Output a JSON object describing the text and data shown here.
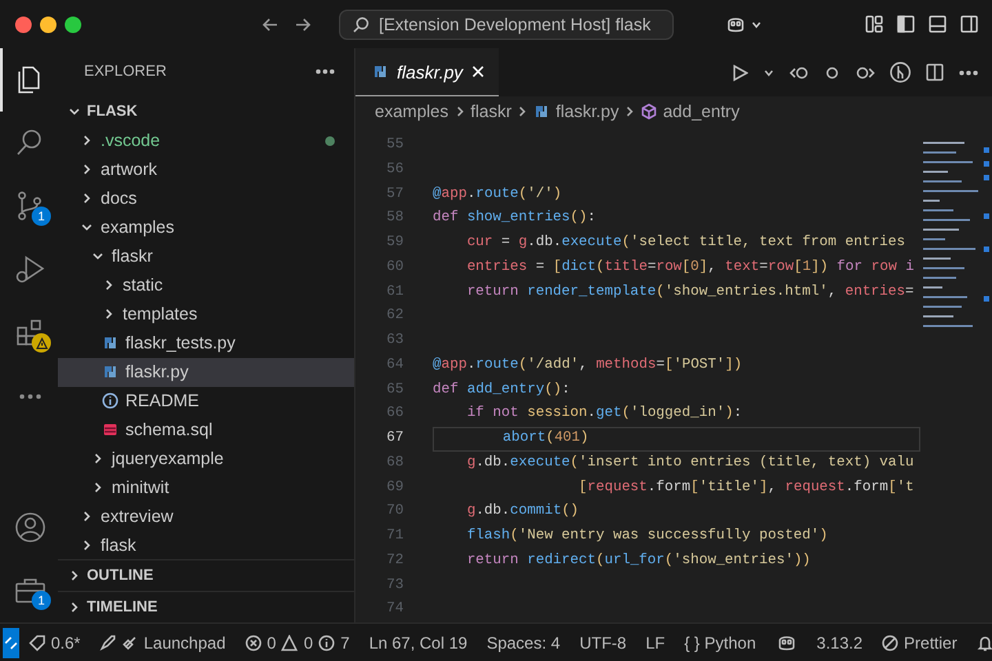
{
  "window": {
    "title": "[Extension Development Host] flask"
  },
  "activity_bar": {
    "items": [
      {
        "kind": "files",
        "selected": true
      },
      {
        "kind": "search",
        "selected": false
      },
      {
        "kind": "source-control",
        "selected": false,
        "badge": {
          "kind": "count",
          "text": "1"
        }
      },
      {
        "kind": "run",
        "selected": false
      },
      {
        "kind": "extensions",
        "selected": false,
        "badge": {
          "kind": "warning"
        }
      },
      {
        "kind": "more",
        "selected": false
      }
    ],
    "bottom": [
      {
        "kind": "account"
      },
      {
        "kind": "manage",
        "badge": {
          "kind": "count",
          "text": "1"
        }
      }
    ]
  },
  "sidebar": {
    "title": "EXPLORER",
    "root": {
      "label": "FLASK",
      "expanded": true
    },
    "tree": [
      {
        "label": ".vscode",
        "kind": "folder",
        "expanded": false,
        "untracked": true,
        "selected": false
      },
      {
        "label": "artwork",
        "kind": "folder",
        "expanded": false,
        "untracked": false,
        "selected": false
      },
      {
        "label": "docs",
        "kind": "folder",
        "expanded": false,
        "untracked": false,
        "selected": false
      },
      {
        "label": "examples",
        "kind": "folder",
        "expanded": true,
        "untracked": false,
        "selected": false,
        "children": [
          {
            "label": "flaskr",
            "kind": "folder",
            "expanded": true,
            "untracked": false,
            "selected": false,
            "children": [
              {
                "label": "static",
                "kind": "folder",
                "expanded": false,
                "untracked": false,
                "selected": false
              },
              {
                "label": "templates",
                "kind": "folder",
                "expanded": false,
                "untracked": false,
                "selected": false
              },
              {
                "label": "flaskr_tests.py",
                "kind": "python",
                "untracked": false,
                "selected": false
              },
              {
                "label": "flaskr.py",
                "kind": "python",
                "untracked": false,
                "selected": true
              },
              {
                "label": "README",
                "kind": "info",
                "untracked": false,
                "selected": false
              },
              {
                "label": "schema.sql",
                "kind": "database",
                "untracked": false,
                "selected": false
              }
            ]
          },
          {
            "label": "jqueryexample",
            "kind": "folder",
            "expanded": false,
            "untracked": false,
            "selected": false
          },
          {
            "label": "minitwit",
            "kind": "folder",
            "expanded": false,
            "untracked": false,
            "selected": false
          }
        ]
      },
      {
        "label": "extreview",
        "kind": "folder",
        "expanded": false,
        "untracked": false,
        "selected": false
      },
      {
        "label": "flask",
        "kind": "folder",
        "expanded": false,
        "untracked": false,
        "selected": false
      }
    ],
    "sections": [
      {
        "label": "OUTLINE",
        "expanded": false
      },
      {
        "label": "TIMELINE",
        "expanded": false
      }
    ]
  },
  "editor": {
    "tabs": [
      {
        "label": "flaskr.py",
        "kind": "python",
        "preview": true,
        "selected": true
      }
    ],
    "breadcrumbs": [
      {
        "label": "examples",
        "kind": "folder"
      },
      {
        "label": "flaskr",
        "kind": "folder"
      },
      {
        "label": "flaskr.py",
        "kind": "python"
      },
      {
        "label": "add_entry",
        "kind": "method"
      }
    ],
    "lines": [
      {
        "number": "55",
        "current": false
      },
      {
        "number": "56",
        "current": false
      },
      {
        "number": "57",
        "current": false,
        "tokens": [
          {
            "kind": "fn",
            "text": "@"
          },
          {
            "kind": "var",
            "text": "app"
          },
          {
            "kind": "p",
            "text": "."
          },
          {
            "kind": "fn",
            "text": "route"
          },
          {
            "kind": "br",
            "text": "("
          },
          {
            "kind": "str",
            "text": "'/'"
          },
          {
            "kind": "br",
            "text": ")"
          }
        ]
      },
      {
        "number": "58",
        "current": false,
        "tokens": [
          {
            "kind": "kw",
            "text": "def "
          },
          {
            "kind": "fn",
            "text": "show_entries"
          },
          {
            "kind": "br",
            "text": "()"
          },
          {
            "kind": "p",
            "text": ":"
          }
        ]
      },
      {
        "number": "59",
        "current": false,
        "tokens": [
          {
            "kind": "var",
            "text": "    cur"
          },
          {
            "kind": "p",
            "text": " = "
          },
          {
            "kind": "var",
            "text": "g"
          },
          {
            "kind": "p",
            "text": ".db."
          },
          {
            "kind": "fn",
            "text": "execute"
          },
          {
            "kind": "br",
            "text": "("
          },
          {
            "kind": "str",
            "text": "'select title, text from entries"
          }
        ]
      },
      {
        "number": "60",
        "current": false,
        "tokens": [
          {
            "kind": "var",
            "text": "    entries"
          },
          {
            "kind": "p",
            "text": " = "
          },
          {
            "kind": "br",
            "text": "["
          },
          {
            "kind": "fn",
            "text": "dict"
          },
          {
            "kind": "br",
            "text": "("
          },
          {
            "kind": "var",
            "text": "title"
          },
          {
            "kind": "p",
            "text": "="
          },
          {
            "kind": "var",
            "text": "row"
          },
          {
            "kind": "br",
            "text": "["
          },
          {
            "kind": "num",
            "text": "0"
          },
          {
            "kind": "br",
            "text": "]"
          },
          {
            "kind": "p",
            "text": ", "
          },
          {
            "kind": "var",
            "text": "text"
          },
          {
            "kind": "p",
            "text": "="
          },
          {
            "kind": "var",
            "text": "row"
          },
          {
            "kind": "br",
            "text": "["
          },
          {
            "kind": "num",
            "text": "1"
          },
          {
            "kind": "br",
            "text": "])"
          },
          {
            "kind": "kw",
            "text": " for "
          },
          {
            "kind": "var",
            "text": "row "
          },
          {
            "kind": "kw",
            "text": "i"
          }
        ]
      },
      {
        "number": "61",
        "current": false,
        "tokens": [
          {
            "kind": "kw",
            "text": "    return "
          },
          {
            "kind": "fn",
            "text": "render_template"
          },
          {
            "kind": "br",
            "text": "("
          },
          {
            "kind": "str",
            "text": "'show_entries.html'"
          },
          {
            "kind": "p",
            "text": ", "
          },
          {
            "kind": "var",
            "text": "entries"
          },
          {
            "kind": "p",
            "text": "="
          }
        ]
      },
      {
        "number": "62",
        "current": false
      },
      {
        "number": "63",
        "current": false
      },
      {
        "number": "64",
        "current": false,
        "tokens": [
          {
            "kind": "fn",
            "text": "@"
          },
          {
            "kind": "var",
            "text": "app"
          },
          {
            "kind": "p",
            "text": "."
          },
          {
            "kind": "fn",
            "text": "route"
          },
          {
            "kind": "br",
            "text": "("
          },
          {
            "kind": "str",
            "text": "'/add'"
          },
          {
            "kind": "p",
            "text": ", "
          },
          {
            "kind": "var",
            "text": "methods"
          },
          {
            "kind": "p",
            "text": "="
          },
          {
            "kind": "br",
            "text": "["
          },
          {
            "kind": "str",
            "text": "'POST'"
          },
          {
            "kind": "br",
            "text": "])"
          }
        ]
      },
      {
        "number": "65",
        "current": false,
        "tokens": [
          {
            "kind": "kw",
            "text": "def "
          },
          {
            "kind": "fn",
            "text": "add_entry"
          },
          {
            "kind": "br",
            "text": "()"
          },
          {
            "kind": "p",
            "text": ":"
          }
        ]
      },
      {
        "number": "66",
        "current": false,
        "tokens": [
          {
            "kind": "kw",
            "text": "    if not "
          },
          {
            "kind": "cls",
            "text": "session"
          },
          {
            "kind": "p",
            "text": "."
          },
          {
            "kind": "fn",
            "text": "get"
          },
          {
            "kind": "br",
            "text": "("
          },
          {
            "kind": "str",
            "text": "'logged_in'"
          },
          {
            "kind": "br",
            "text": ")"
          },
          {
            "kind": "p",
            "text": ":"
          }
        ]
      },
      {
        "number": "67",
        "current": true,
        "tokens": [
          {
            "kind": "fn",
            "text": "        abort"
          },
          {
            "kind": "br",
            "text": "("
          },
          {
            "kind": "num",
            "text": "401"
          },
          {
            "kind": "br",
            "text": ")"
          }
        ]
      },
      {
        "number": "68",
        "current": false,
        "tokens": [
          {
            "kind": "var",
            "text": "    g"
          },
          {
            "kind": "p",
            "text": ".db."
          },
          {
            "kind": "fn",
            "text": "execute"
          },
          {
            "kind": "br",
            "text": "("
          },
          {
            "kind": "str",
            "text": "'insert into entries (title, text) valu"
          }
        ]
      },
      {
        "number": "69",
        "current": false,
        "tokens": [
          {
            "kind": "br",
            "text": "                 ["
          },
          {
            "kind": "var",
            "text": "request"
          },
          {
            "kind": "p",
            "text": ".form"
          },
          {
            "kind": "br",
            "text": "["
          },
          {
            "kind": "str",
            "text": "'title'"
          },
          {
            "kind": "br",
            "text": "]"
          },
          {
            "kind": "p",
            "text": ", "
          },
          {
            "kind": "var",
            "text": "request"
          },
          {
            "kind": "p",
            "text": ".form"
          },
          {
            "kind": "br",
            "text": "["
          },
          {
            "kind": "str",
            "text": "'t"
          }
        ]
      },
      {
        "number": "70",
        "current": false,
        "tokens": [
          {
            "kind": "var",
            "text": "    g"
          },
          {
            "kind": "p",
            "text": ".db."
          },
          {
            "kind": "fn",
            "text": "commit"
          },
          {
            "kind": "br",
            "text": "()"
          }
        ]
      },
      {
        "number": "71",
        "current": false,
        "tokens": [
          {
            "kind": "fn",
            "text": "    flash"
          },
          {
            "kind": "br",
            "text": "("
          },
          {
            "kind": "str",
            "text": "'New entry was successfully posted'"
          },
          {
            "kind": "br",
            "text": ")"
          }
        ]
      },
      {
        "number": "72",
        "current": false,
        "tokens": [
          {
            "kind": "kw",
            "text": "    return "
          },
          {
            "kind": "fn",
            "text": "redirect"
          },
          {
            "kind": "br",
            "text": "("
          },
          {
            "kind": "fn",
            "text": "url_for"
          },
          {
            "kind": "br",
            "text": "("
          },
          {
            "kind": "str",
            "text": "'show_entries'"
          },
          {
            "kind": "br",
            "text": "))"
          }
        ]
      },
      {
        "number": "73",
        "current": false
      },
      {
        "number": "74",
        "current": false
      }
    ]
  },
  "status_bar": {
    "items": [
      {
        "kind": "remote"
      },
      {
        "kind": "sync",
        "text": "0.6*"
      },
      {
        "kind": "launchpad",
        "text": "Launchpad"
      },
      {
        "kind": "problems",
        "errors": "0",
        "warnings": "0",
        "infos": "7"
      },
      {
        "kind": "text",
        "text": "Ln 67, Col 19"
      },
      {
        "kind": "text",
        "text": "Spaces: 4"
      },
      {
        "kind": "text",
        "text": "UTF-8"
      },
      {
        "kind": "text",
        "text": "LF"
      },
      {
        "kind": "language",
        "icon_text": "{ }",
        "text": "Python"
      },
      {
        "kind": "copilot"
      },
      {
        "kind": "text",
        "text": "3.13.2"
      },
      {
        "kind": "prettier",
        "text": "Prettier"
      },
      {
        "kind": "bell"
      }
    ]
  }
}
